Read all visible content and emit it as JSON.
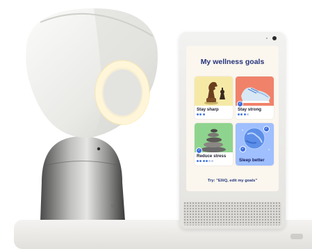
{
  "screen": {
    "title": "My wellness goals",
    "goals": [
      {
        "label": "Stay sharp",
        "progress_dots_filled": 3,
        "progress_dots_total": 3,
        "icon": "chess-knight-icon",
        "completed": false
      },
      {
        "label": "Stay strong",
        "progress_dots_filled": 3,
        "progress_dots_total": 4,
        "icon": "sneaker-icon",
        "completed": true
      },
      {
        "label": "Reduce stress",
        "progress_dots_filled": 4,
        "progress_dots_total": 6,
        "icon": "stacked-stones-icon",
        "completed": true
      },
      {
        "label": "Sleep better",
        "icon": "planet-icon",
        "completed": true
      }
    ],
    "hint": "Try: \"ElliQ, edit my goals\""
  },
  "robot": {
    "brand": "ElliQ"
  },
  "colors": {
    "title_text": "#23337c",
    "accent_blue": "#3a6ee0",
    "screen_bg": "#fbf6ee",
    "robot_ring": "#fff3cf",
    "card_stay_sharp": "#f6e9a6",
    "card_stay_strong": "#f0826a",
    "card_reduce_stress": "#8fd48e",
    "card_sleep_better": "#9fbfff"
  }
}
